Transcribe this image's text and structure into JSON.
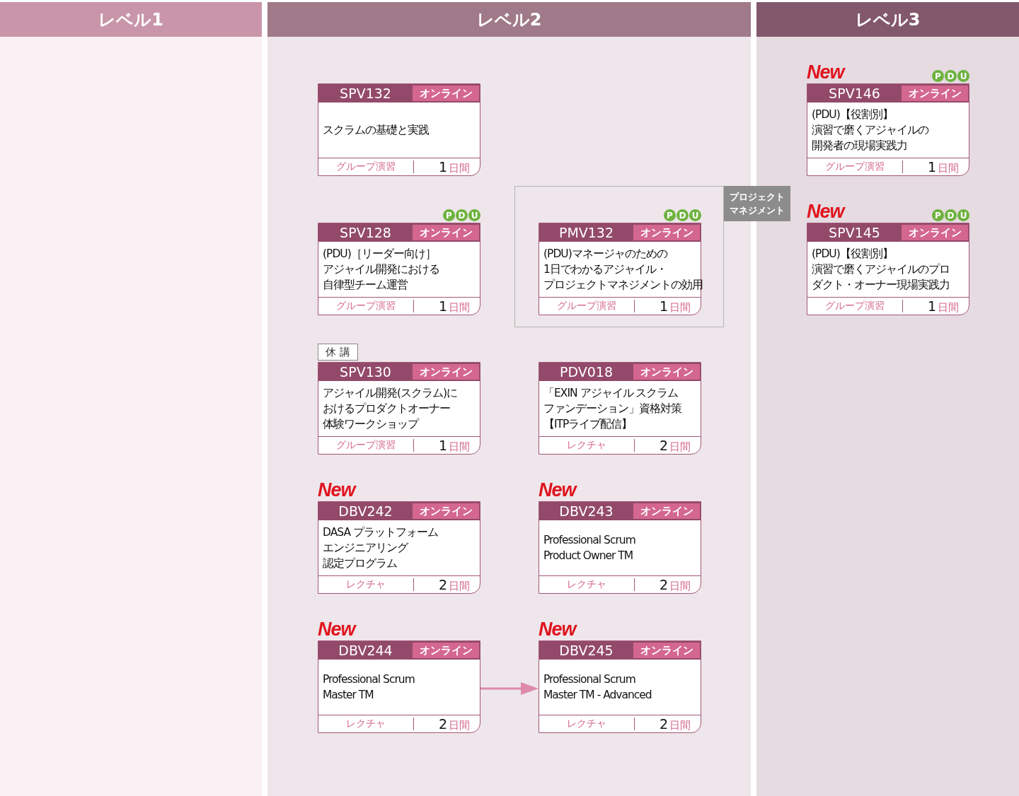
{
  "levels": [
    {
      "title": "レベル1"
    },
    {
      "title": "レベル2",
      "rows": [
        {
          "courses": [
            {
              "code": "SPV132",
              "delivery": "オンライン",
              "title": [
                "スクラムの基礎と実践"
              ],
              "format": "グループ演習",
              "days": "1",
              "days_unit": "日間"
            }
          ]
        },
        {
          "courses": [
            {
              "code": "SPV128",
              "delivery": "オンライン",
              "pdu": [
                "P",
                "D",
                "U"
              ],
              "title": [
                "(PDU)［リーダー向け］",
                "アジャイル開発における",
                "自律型チーム運営"
              ],
              "format": "グループ演習",
              "days": "1",
              "days_unit": "日間"
            },
            {
              "code": "PMV132",
              "delivery": "オンライン",
              "pdu": [
                "P",
                "D",
                "U"
              ],
              "category": [
                "プロジェクト",
                "マネジメント"
              ],
              "title": [
                "(PDU)マネージャのための",
                "1日でわかるアジャイル・",
                "プロジェクトマネジメントの効用"
              ],
              "format": "グループ演習",
              "days": "1",
              "days_unit": "日間"
            }
          ]
        },
        {
          "courses": [
            {
              "code": "SPV130",
              "delivery": "オンライン",
              "notice": "休 講",
              "title": [
                "アジャイル開発(スクラム)に",
                "おけるプロダクトオーナー",
                "体験ワークショップ"
              ],
              "format": "グループ演習",
              "days": "1",
              "days_unit": "日間"
            },
            {
              "code": "PDV018",
              "delivery": "オンライン",
              "title": [
                "「EXIN アジャイル スクラム",
                "ファンデーション」資格対策",
                "【ITPライブ配信】"
              ],
              "format": "レクチャ",
              "days": "2",
              "days_unit": "日間"
            }
          ]
        },
        {
          "courses": [
            {
              "code": "DBV242",
              "delivery": "オンライン",
              "new": "New",
              "title": [
                "DASA プラットフォーム",
                "エンジニアリング",
                "認定プログラム"
              ],
              "format": "レクチャ",
              "days": "2",
              "days_unit": "日間"
            },
            {
              "code": "DBV243",
              "delivery": "オンライン",
              "new": "New",
              "title": [
                "Professional Scrum",
                "Product Owner TM"
              ],
              "format": "レクチャ",
              "days": "2",
              "days_unit": "日間"
            }
          ]
        },
        {
          "arrow": true,
          "courses": [
            {
              "code": "DBV244",
              "delivery": "オンライン",
              "new": "New",
              "title": [
                "Professional Scrum",
                "Master TM"
              ],
              "format": "レクチャ",
              "days": "2",
              "days_unit": "日間"
            },
            {
              "code": "DBV245",
              "delivery": "オンライン",
              "new": "New",
              "title": [
                "Professional Scrum",
                "Master TM - Advanced"
              ],
              "format": "レクチャ",
              "days": "2",
              "days_unit": "日間"
            }
          ]
        }
      ]
    },
    {
      "title": "レベル3",
      "rows": [
        {
          "courses": [
            {
              "code": "SPV146",
              "delivery": "オンライン",
              "new": "New",
              "pdu": [
                "P",
                "D",
                "U"
              ],
              "title": [
                "(PDU)【役割別】",
                "演習で磨くアジャイルの",
                "開発者の現場実践力"
              ],
              "format": "グループ演習",
              "days": "1",
              "days_unit": "日間"
            }
          ]
        },
        {
          "courses": [
            {
              "code": "SPV145",
              "delivery": "オンライン",
              "new": "New",
              "pdu": [
                "P",
                "D",
                "U"
              ],
              "title": [
                "(PDU)【役割別】",
                "演習で磨くアジャイルのプロ",
                "ダクト・オーナー現場実践力"
              ],
              "format": "グループ演習",
              "days": "1",
              "days_unit": "日間"
            }
          ]
        }
      ]
    }
  ]
}
